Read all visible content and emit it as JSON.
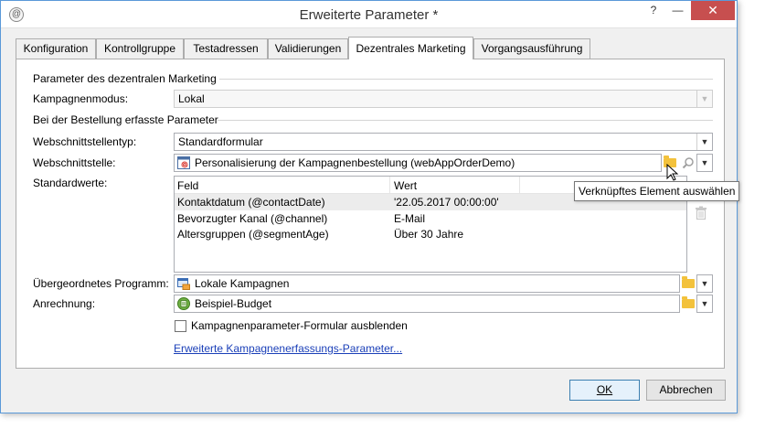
{
  "window": {
    "title": "Erweiterte Parameter *",
    "help_button": "?",
    "minimize_button": "—",
    "close_button": "✕"
  },
  "tabs": [
    {
      "label": "Konfiguration"
    },
    {
      "label": "Kontrollgruppe"
    },
    {
      "label": "Testadressen"
    },
    {
      "label": "Validierungen"
    },
    {
      "label": "Dezentrales Marketing",
      "active": true
    },
    {
      "label": "Vorgangsausführung"
    }
  ],
  "section1": {
    "heading": "Parameter des dezentralen Marketing",
    "campaign_mode_label": "Kampagnenmodus:",
    "campaign_mode_value": "Lokal"
  },
  "section2": {
    "heading": "Bei der Bestellung erfasste Parameter",
    "interface_type_label": "Webschnittstellentyp:",
    "interface_type_value": "Standardformular",
    "interface_label": "Webschnittstelle:",
    "interface_value": "Personalisierung der Kampagnenbestellung (webAppOrderDemo)",
    "defaults_label": "Standardwerte:"
  },
  "defaults_table": {
    "columns": [
      "Feld",
      "Wert"
    ],
    "rows": [
      {
        "field": "Kontaktdatum (@contactDate)",
        "value": "'22.05.2017 00:00:00'"
      },
      {
        "field": "Bevorzugter Kanal (@channel)",
        "value": "E-Mail"
      },
      {
        "field": "Altersgruppen (@segmentAge)",
        "value": "Über 30 Jahre"
      }
    ]
  },
  "tooltip": "Verknüpftes Element auswählen",
  "program": {
    "label": "Übergeordnetes Programm:",
    "value": "Lokale Kampagnen"
  },
  "budget": {
    "label": "Anrechnung:",
    "value": "Beispiel-Budget"
  },
  "hide_form_checkbox": {
    "label": "Kampagnenparameter-Formular ausblenden",
    "checked": false
  },
  "advanced_link": "Erweiterte Kampagnenerfassungs-Parameter...",
  "buttons": {
    "ok": "OK",
    "cancel": "Abbrechen"
  },
  "icons": {
    "folder": "folder-icon",
    "search": "magnifier-icon",
    "dropdown": "chevron-down-icon",
    "delete": "trash-icon",
    "webapp": "webapp-icon",
    "program": "program-icon",
    "budget": "budget-icon"
  },
  "colors": {
    "accent_border": "#5a99d8",
    "close_button": "#c74f4f",
    "link": "#1a3fb8",
    "folder": "#f3c23c"
  }
}
